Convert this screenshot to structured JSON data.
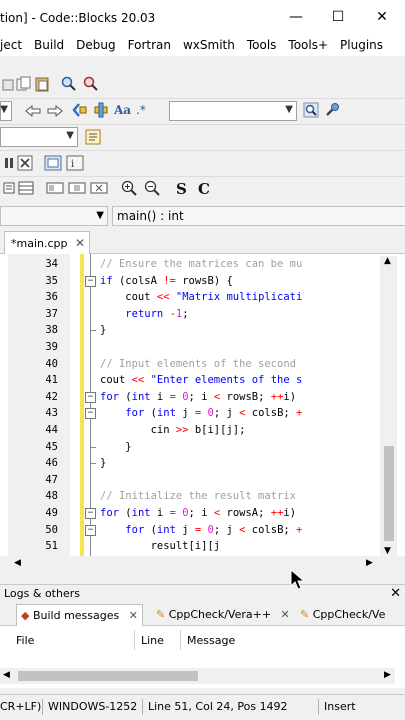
{
  "window": {
    "title": "tion] - Code::Blocks 20.03",
    "minimize": "—",
    "maximize": "☐",
    "close": "✕"
  },
  "menu": [
    "ject",
    "Build",
    "Debug",
    "Fortran",
    "wxSmith",
    "Tools",
    "Tools+",
    "Plugins"
  ],
  "scope": {
    "function": "main() : int"
  },
  "editor_tab": {
    "label": "*main.cpp",
    "close": "✕"
  },
  "code_lines": [
    {
      "n": "34",
      "html": "<span class=\"cm\">// Ensure the matrices can be mu</span>"
    },
    {
      "n": "35",
      "html": "<span class=\"kw\">if</span> (colsA <span class=\"op\">!=</span> rowsB) {"
    },
    {
      "n": "36",
      "html": "    cout <span class=\"op\">&lt;&lt;</span> <span class=\"st\">\"Matrix multiplicati</span>"
    },
    {
      "n": "37",
      "html": "    <span class=\"kw\">return</span> <span class=\"op\">-</span><span class=\"nm\">1</span>;"
    },
    {
      "n": "38",
      "html": "}"
    },
    {
      "n": "39",
      "html": ""
    },
    {
      "n": "40",
      "html": "<span class=\"cm\">// Input elements of the second</span>"
    },
    {
      "n": "41",
      "html": "cout <span class=\"op\">&lt;&lt;</span> <span class=\"st\">\"Enter elements of the s</span>"
    },
    {
      "n": "42",
      "html": "<span class=\"kw\">for</span> (<span class=\"kw\">int</span> i <span class=\"op\">=</span> <span class=\"nm\">0</span>; i <span class=\"op\">&lt;</span> rowsB; <span class=\"op\">++</span>i)"
    },
    {
      "n": "43",
      "html": "    <span class=\"kw\">for</span> (<span class=\"kw\">int</span> j <span class=\"op\">=</span> <span class=\"nm\">0</span>; j <span class=\"op\">&lt;</span> colsB; <span class=\"op\">+</span>"
    },
    {
      "n": "44",
      "html": "        cin <span class=\"op\">&gt;&gt;</span> b[i][j];"
    },
    {
      "n": "45",
      "html": "    }"
    },
    {
      "n": "46",
      "html": "}"
    },
    {
      "n": "47",
      "html": ""
    },
    {
      "n": "48",
      "html": "<span class=\"cm\">// Initialize the result matrix</span>"
    },
    {
      "n": "49",
      "html": "<span class=\"kw\">for</span> (<span class=\"kw\">int</span> i <span class=\"op\">=</span> <span class=\"nm\">0</span>; i <span class=\"op\">&lt;</span> rowsA; <span class=\"op\">++</span>i)"
    },
    {
      "n": "50",
      "html": "    <span class=\"kw\">for</span> (<span class=\"kw\">int</span> j <span class=\"op\">=</span> <span class=\"nm\">0</span>; j <span class=\"op\">&lt;</span> colsB; <span class=\"op\">+</span>"
    },
    {
      "n": "51",
      "html": "        result[i][j"
    }
  ],
  "logs": {
    "title": "Logs & others",
    "close": "✕",
    "tabs": [
      {
        "label": "Build messages"
      },
      {
        "label": "CppCheck/Vera++"
      },
      {
        "label": "CppCheck/Ve"
      }
    ],
    "columns": [
      "File",
      "Line",
      "Message"
    ]
  },
  "status": {
    "eol": "CR+LF)",
    "encoding": "WINDOWS-1252",
    "position": "Line 51, Col 24, Pos 1492",
    "mode": "Insert"
  }
}
